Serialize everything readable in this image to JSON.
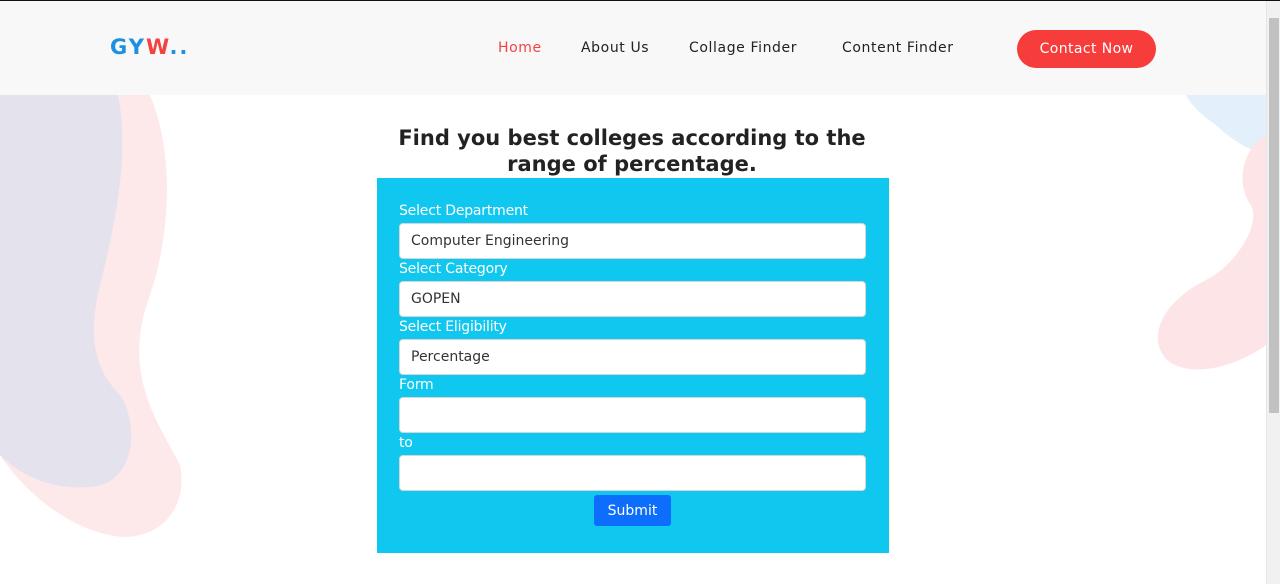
{
  "brand": {
    "logo_main": "GY",
    "logo_accent": "W",
    "logo_dots": ".."
  },
  "nav": {
    "home": "Home",
    "about": "About Us",
    "college_finder": "Collage Finder",
    "content_finder": "Content Finder",
    "contact_button": "Contact Now"
  },
  "main": {
    "heading": "Find you best colleges according to the range of percentage."
  },
  "form": {
    "department": {
      "label": "Select Department",
      "value": "Computer Engineering"
    },
    "category": {
      "label": "Select Category",
      "value": "GOPEN"
    },
    "eligibility": {
      "label": "Select Eligibility",
      "value": "Percentage"
    },
    "from": {
      "label": "Form",
      "value": ""
    },
    "to": {
      "label": "to",
      "value": ""
    },
    "submit_label": "Submit"
  },
  "colors": {
    "accent_red": "#f73c3c",
    "brand_blue": "#1e90e0",
    "panel_cyan": "#10c8ef",
    "submit_blue": "#0d6efd"
  }
}
